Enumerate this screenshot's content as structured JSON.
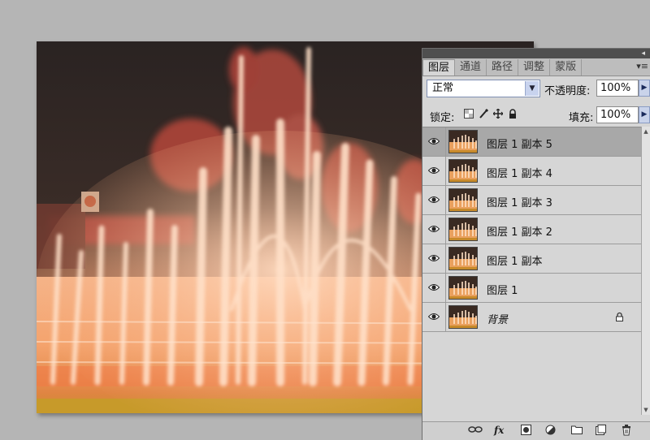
{
  "layers_panel": {
    "tabs": [
      {
        "label": "图层",
        "active": true
      },
      {
        "label": "通道",
        "active": false
      },
      {
        "label": "路径",
        "active": false
      },
      {
        "label": "调整",
        "active": false
      },
      {
        "label": "蒙版",
        "active": false
      }
    ],
    "menu_icon": "▾≡",
    "blend_mode": "正常",
    "opacity_label": "不透明度:",
    "opacity_value": "100%",
    "lock_label": "锁定:",
    "fill_label": "填充:",
    "fill_value": "100%",
    "layers": [
      {
        "name": "图层 1 副本 5",
        "selected": true,
        "locked": false,
        "italic": false
      },
      {
        "name": "图层 1 副本 4",
        "selected": false,
        "locked": false,
        "italic": false
      },
      {
        "name": "图层 1 副本 3",
        "selected": false,
        "locked": false,
        "italic": false
      },
      {
        "name": "图层 1 副本 2",
        "selected": false,
        "locked": false,
        "italic": false
      },
      {
        "name": "图层 1 副本",
        "selected": false,
        "locked": false,
        "italic": false
      },
      {
        "name": "图层 1",
        "selected": false,
        "locked": false,
        "italic": false
      },
      {
        "name": "背景",
        "selected": false,
        "locked": true,
        "italic": true
      }
    ],
    "bottom_icons": [
      "link-icon",
      "fx-icon",
      "mask-icon",
      "adjustment-icon",
      "group-folder-icon",
      "new-layer-icon",
      "trash-icon"
    ],
    "fx_label": "fx"
  },
  "colors": {
    "panel_bg": "#d6d6d6",
    "selected_row": "#a8a8a8",
    "canvas_bg": "#2b2424",
    "fountain_orange": "#f3a070",
    "red_blob": "#c0392b"
  }
}
